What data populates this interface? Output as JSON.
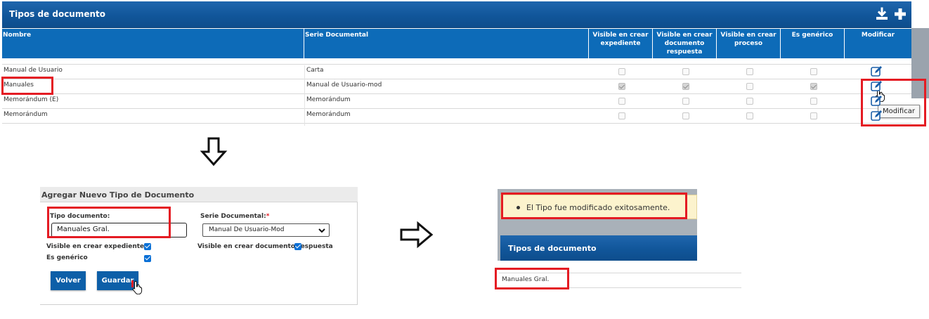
{
  "table": {
    "title": "Tipos de documento",
    "icons": [
      "download-icon",
      "plus-icon"
    ],
    "headers": {
      "nombre": "Nombre",
      "serie": "Serie Documental",
      "visible_expediente": "Visible en crear expediente",
      "visible_respuesta": "Visible en crear documento respuesta",
      "visible_proceso": "Visible en crear proceso",
      "generico": "Es genérico",
      "modificar": "Modificar"
    },
    "rows": [
      {
        "nombre": "Manual de Usuario",
        "serie": "Carta",
        "checks": [
          false,
          false,
          false,
          false
        ]
      },
      {
        "nombre": "Manuales",
        "serie": "Manual de Usuario-mod",
        "checks": [
          true,
          true,
          false,
          true
        ]
      },
      {
        "nombre": "Memorándum (E)",
        "serie": "Memorándum",
        "checks": [
          false,
          false,
          false,
          false
        ]
      },
      {
        "nombre": "Memorándum",
        "serie": "Memorándum",
        "checks": [
          false,
          false,
          false,
          false
        ]
      }
    ],
    "tooltip": "Modificar"
  },
  "form": {
    "title": "Agregar Nuevo Tipo de Documento",
    "tipo_label": "Tipo documento:",
    "tipo_value": "Manuales Gral.",
    "serie_label": "Serie Documental:",
    "serie_required": "*",
    "serie_value": "Manual De Usuario-Mod",
    "visible_expediente_label": "Visible en crear expediente",
    "visible_respuesta_label": "Visible en crear documento respuesta",
    "generico_label": "Es genérico",
    "checks": {
      "visible_expediente": true,
      "visible_respuesta": true,
      "generico": true
    },
    "back_label": "Volver",
    "save_label": "Guardar"
  },
  "result": {
    "message": "El Tipo fue modificado exitosamente.",
    "title": "Tipos de documento",
    "row_value": "Manuales Gral."
  },
  "colors": {
    "header_blue": "#0d6bb8",
    "highlight_red": "#e41b23",
    "success_bg": "#fcf3cd"
  }
}
